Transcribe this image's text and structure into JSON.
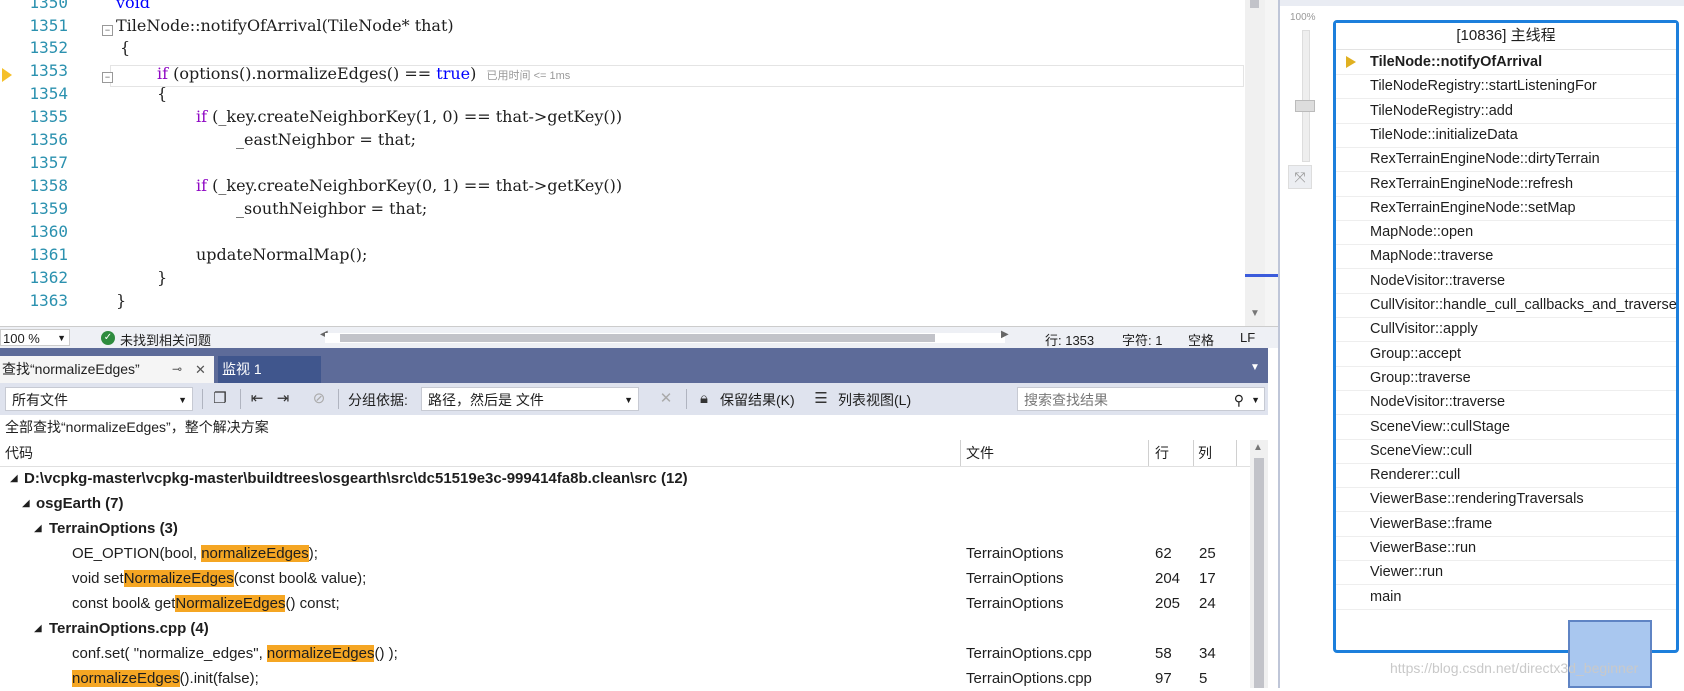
{
  "editor": {
    "line_numbers": [
      "1350",
      "1351",
      "1352",
      "1353",
      "1354",
      "1355",
      "1356",
      "1357",
      "1358",
      "1359",
      "1360",
      "1361",
      "1362",
      "1363"
    ],
    "lines": {
      "l1350": "void",
      "l1351": "TileNode::notifyOfArrival(TileNode* that)",
      "l1352": "{",
      "l1353_if": "if",
      "l1353_mid": " (options().normalizeEdges() == ",
      "l1353_true": "true",
      "l1353_end": ")",
      "l1353_hint": "已用时间 <= 1ms",
      "l1354": "{",
      "l1355_if": "if",
      "l1355_rest": " (_key.createNeighborKey(1, 0) == that->getKey())",
      "l1356": "_eastNeighbor = that;",
      "l1358_if": "if",
      "l1358_rest": " (_key.createNeighborKey(0, 1) == that->getKey())",
      "l1359": "_southNeighbor = that;",
      "l1361": "updateNormalMap();",
      "l1362": "}",
      "l1363": "}"
    }
  },
  "status_bar": {
    "zoom": "100 %",
    "issues": "未找到相关问题",
    "line": "行: 1353",
    "char": "字符: 1",
    "spaces": "空格",
    "eol": "LF"
  },
  "find_panel": {
    "tabs": {
      "find": "查找“normalizeEdges”",
      "pin": "⊸",
      "close": "✕",
      "watch": "监视 1"
    },
    "scope": "所有文件",
    "group_by_label": "分组依据:",
    "group_by_value": "路径，然后是 文件",
    "keep_results": "保留结果(K)",
    "list_view": "列表视图(L)",
    "search_placeholder": "搜索查找结果",
    "description": "全部查找“normalizeEdges”，整个解决方案",
    "columns": {
      "code": "代码",
      "file": "文件",
      "row": "行",
      "col": "列"
    },
    "tree": {
      "root": "D:\\vcpkg-master\\vcpkg-master\\buildtrees\\osgearth\\src\\dc51519e3c-999414fa8b.clean\\src (12)",
      "osg": "osgEarth (7)",
      "f1": "TerrainOptions (3)",
      "f2": "TerrainOptions.cpp (4)"
    },
    "results": [
      {
        "pre": "OE_OPTION(bool, ",
        "match": "normalizeEdges",
        "post": ");",
        "file": "TerrainOptions",
        "row": "62",
        "col": "25"
      },
      {
        "pre": "void set",
        "match": "NormalizeEdges",
        "post": "(const bool& value);",
        "file": "TerrainOptions",
        "row": "204",
        "col": "17"
      },
      {
        "pre": "const bool& get",
        "match": "NormalizeEdges",
        "post": "() const;",
        "file": "TerrainOptions",
        "row": "205",
        "col": "24"
      },
      {
        "pre": "conf.set( \"normalize_edges\", ",
        "match": "normalizeEdges",
        "post": "() );",
        "file": "TerrainOptions.cpp",
        "row": "58",
        "col": "34"
      },
      {
        "pre": "",
        "match": "normalizeEdges",
        "post": "().init(false);",
        "file": "TerrainOptions.cpp",
        "row": "97",
        "col": "5"
      }
    ]
  },
  "zoom_slider": {
    "label": "100%"
  },
  "call_stack": {
    "title": "[10836] 主线程",
    "frames": [
      "TileNode::notifyOfArrival",
      "TileNodeRegistry::startListeningFor",
      "TileNodeRegistry::add",
      "TileNode::initializeData",
      "RexTerrainEngineNode::dirtyTerrain",
      "RexTerrainEngineNode::refresh",
      "RexTerrainEngineNode::setMap",
      "MapNode::open",
      "MapNode::traverse",
      "NodeVisitor::traverse",
      "CullVisitor::handle_cull_callbacks_and_traverse",
      "CullVisitor::apply",
      "Group::accept",
      "Group::traverse",
      "NodeVisitor::traverse",
      "SceneView::cullStage",
      "SceneView::cull",
      "Renderer::cull",
      "ViewerBase::renderingTraversals",
      "ViewerBase::frame",
      "ViewerBase::run",
      "Viewer::run",
      "main"
    ]
  },
  "watermark": "https://blog.csdn.net/directx3d_beginner",
  "colors": {
    "accent": "#1c7fdc",
    "highlight": "#f5a623",
    "tabstrip": "#5d6b99"
  },
  "icons": [
    "breakpoint-arrow-icon",
    "check-icon",
    "dropdown-icon",
    "copy-icon",
    "prev-result-icon",
    "next-result-icon",
    "clear-filter-icon",
    "lock-icon",
    "list-view-icon",
    "search-icon",
    "pin-icon",
    "close-icon",
    "current-frame-icon"
  ]
}
